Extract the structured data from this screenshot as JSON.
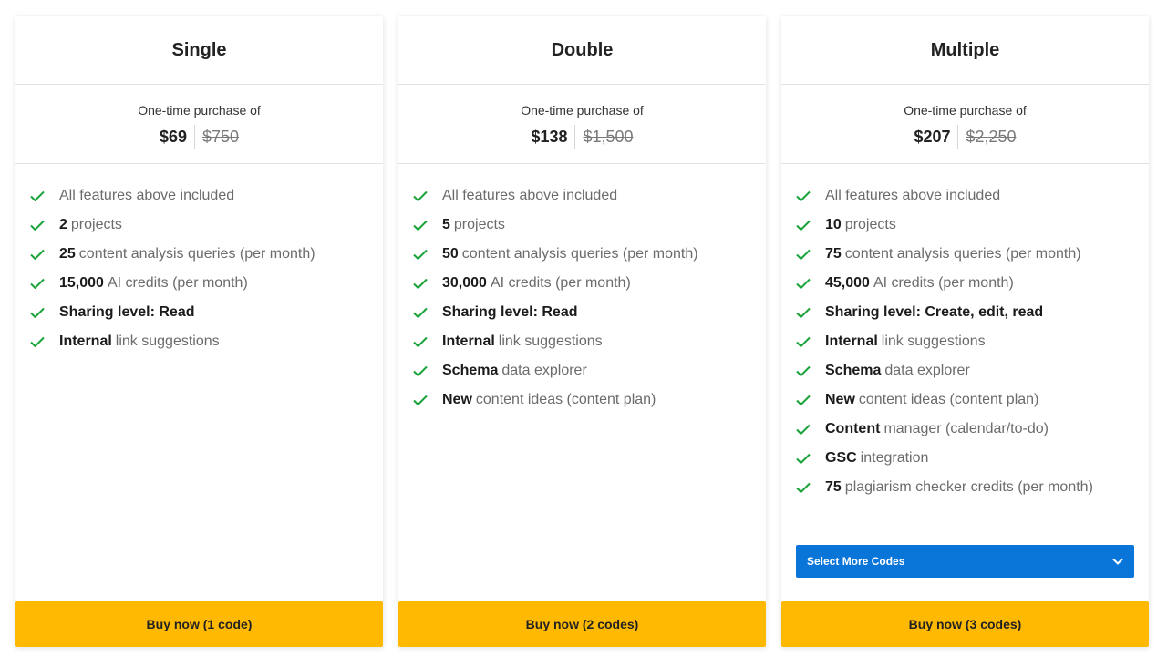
{
  "plans": [
    {
      "title": "Single",
      "price_caption": "One-time purchase of",
      "price": "$69",
      "old_price": "$750",
      "features": [
        {
          "strong": "",
          "text": "All features above included"
        },
        {
          "strong": "2",
          "text": "projects"
        },
        {
          "strong": "25",
          "text": "content analysis queries (per month)"
        },
        {
          "strong": "15,000",
          "text": "AI credits (per month)"
        },
        {
          "strong": "Sharing level: Read",
          "text": ""
        },
        {
          "strong": "Internal",
          "text": "link suggestions"
        }
      ],
      "button": "Buy now (1 code)"
    },
    {
      "title": "Double",
      "price_caption": "One-time purchase of",
      "price": "$138",
      "old_price": "$1,500",
      "features": [
        {
          "strong": "",
          "text": "All features above included"
        },
        {
          "strong": "5",
          "text": "projects"
        },
        {
          "strong": "50",
          "text": "content analysis queries (per month)"
        },
        {
          "strong": "30,000",
          "text": "AI credits (per month)"
        },
        {
          "strong": "Sharing level: Read",
          "text": ""
        },
        {
          "strong": "Internal",
          "text": "link suggestions"
        },
        {
          "strong": "Schema",
          "text": "data explorer"
        },
        {
          "strong": "New",
          "text": "content ideas (content plan)"
        }
      ],
      "button": "Buy now (2 codes)"
    },
    {
      "title": "Multiple",
      "price_caption": "One-time purchase of",
      "price": "$207",
      "old_price": "$2,250",
      "features": [
        {
          "strong": "",
          "text": "All features above included"
        },
        {
          "strong": "10",
          "text": "projects"
        },
        {
          "strong": "75",
          "text": "content analysis queries (per month)"
        },
        {
          "strong": "45,000",
          "text": "AI credits (per month)"
        },
        {
          "strong": "Sharing level: Create, edit, read",
          "text": ""
        },
        {
          "strong": "Internal",
          "text": "link suggestions"
        },
        {
          "strong": "Schema",
          "text": "data explorer"
        },
        {
          "strong": "New",
          "text": "content ideas (content plan)"
        },
        {
          "strong": "Content",
          "text": "manager (calendar/to-do)"
        },
        {
          "strong": "GSC",
          "text": "integration"
        },
        {
          "strong": "75",
          "text": "plagiarism checker credits (per month)"
        }
      ],
      "select_more": "Select More Codes",
      "button": "Buy now (3 codes)"
    }
  ],
  "colors": {
    "check": "#1aa33a",
    "buy_button": "#ffb900",
    "select_more": "#0a75d8"
  },
  "icons": {
    "feature": "check-icon",
    "dropdown": "chevron-down-icon"
  }
}
